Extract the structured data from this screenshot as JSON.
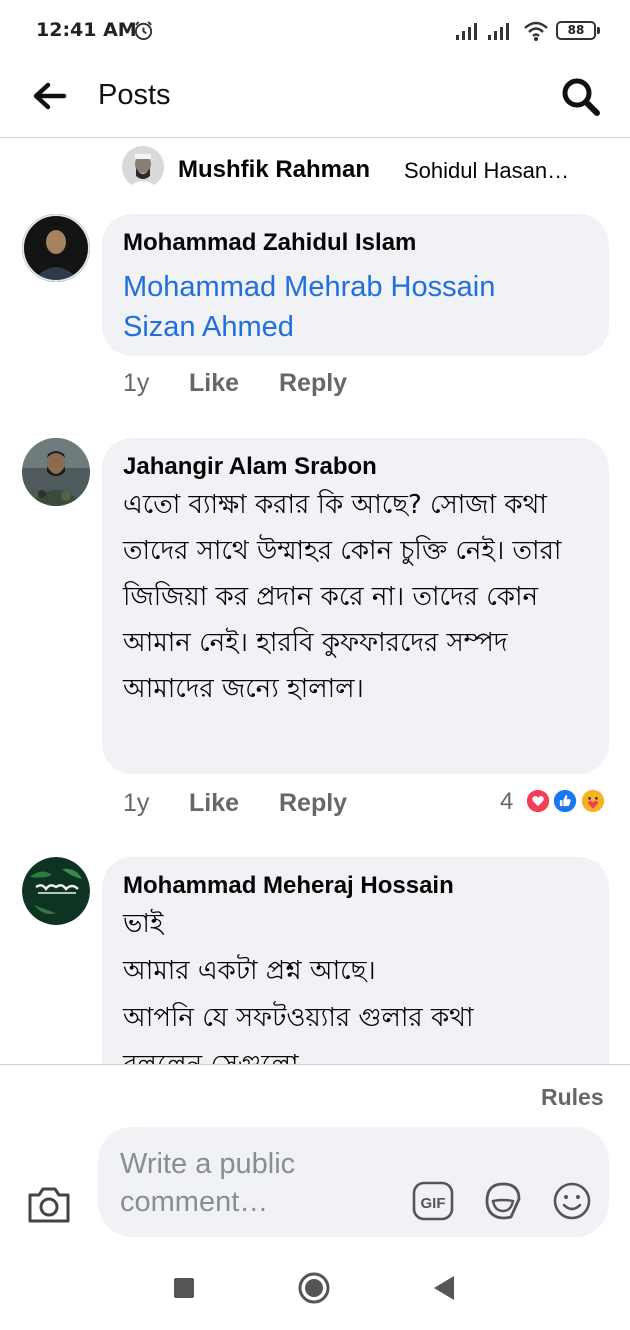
{
  "status_bar": {
    "time": "12:41 AM",
    "battery": "88"
  },
  "header": {
    "title": "Posts"
  },
  "collapsed_reply": {
    "author": "Mushfik Rahman",
    "snippet": "Sohidul Hasan…"
  },
  "comments": [
    {
      "author": "Mohammad Zahidul Islam",
      "mentions": [
        "Mohammad Mehrab Hossain",
        "Sizan Ahmed"
      ],
      "time": "1y",
      "like": "Like",
      "reply": "Reply"
    },
    {
      "author": "Jahangir Alam Srabon",
      "text": "এতো ব্যাক্ষা করার কি আছে? সোজা কথা তাদের সাথে উম্মাহর কোন চুক্তি নেই। তারা জিজিয়া কর প্রদান করে না। তাদের কোন আমান নেই। হারবি কুফফারদের সম্পদ আমাদের জন্যে হালাল।",
      "time": "1y",
      "like": "Like",
      "reply": "Reply",
      "reaction_count": "4",
      "reactions": [
        "love-reaction",
        "like-reaction",
        "care-reaction"
      ]
    },
    {
      "author": "Mohammad Meheraj Hossain",
      "lines": [
        "ভাই",
        "আমার একটা প্রশ্ন আছে।",
        "আপনি যে সফটওয়্যার গুলার কথা",
        "বললেন সেগুলো"
      ]
    }
  ],
  "composer": {
    "rules": "Rules",
    "placeholder": "Write a public comment…",
    "gif_label": "GIF"
  },
  "colors": {
    "bubble": "#f0f2f5",
    "mention": "#216fdb",
    "meta": "#65676b",
    "love": "#f33e58",
    "like": "#1877f2",
    "care": "#f7b125"
  }
}
